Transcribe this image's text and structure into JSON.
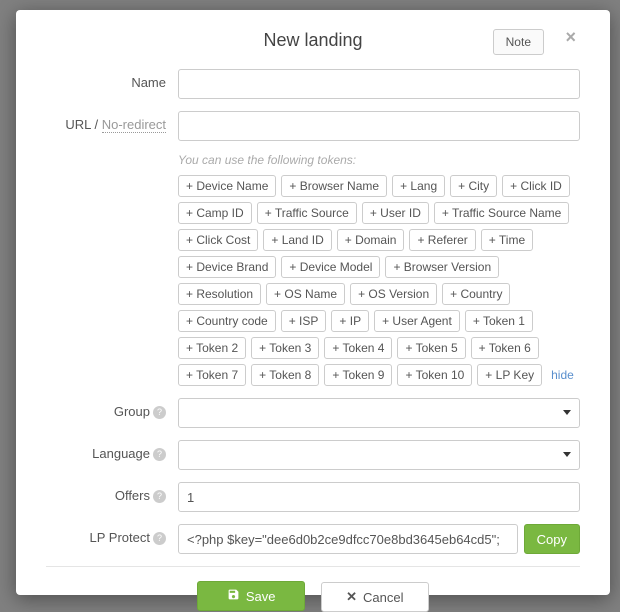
{
  "header": {
    "title": "New landing",
    "note_label": "Note",
    "close_symbol": "×"
  },
  "labels": {
    "name": "Name",
    "url_prefix": "URL / ",
    "url_noredirect": "No-redirect",
    "group": "Group",
    "language": "Language",
    "offers": "Offers",
    "lp_protect": "LP Protect"
  },
  "tokens_hint": "You can use the following tokens:",
  "tokens": [
    "+ Device Name",
    "+ Browser Name",
    "+ Lang",
    "+ City",
    "+ Click ID",
    "+ Camp ID",
    "+ Traffic Source",
    "+ User ID",
    "+ Traffic Source Name",
    "+ Click Cost",
    "+ Land ID",
    "+ Domain",
    "+ Referer",
    "+ Time",
    "+ Device Brand",
    "+ Device Model",
    "+ Browser Version",
    "+ Resolution",
    "+ OS Name",
    "+ OS Version",
    "+ Country",
    "+ Country code",
    "+ ISP",
    "+ IP",
    "+ User Agent",
    "+ Token 1",
    "+ Token 2",
    "+ Token 3",
    "+ Token 4",
    "+ Token 5",
    "+ Token 6",
    "+ Token 7",
    "+ Token 8",
    "+ Token 9",
    "+ Token 10",
    "+ LP Key"
  ],
  "hide_label": "hide",
  "fields": {
    "name_value": "",
    "url_value": "",
    "group_value": "",
    "language_value": "",
    "offers_value": "1",
    "lp_protect_value": "<?php $key=\"dee6d0b2ce9dfcc70e8bd3645eb64cd5\";"
  },
  "buttons": {
    "copy": "Copy",
    "save": "Save",
    "cancel": "Cancel"
  }
}
